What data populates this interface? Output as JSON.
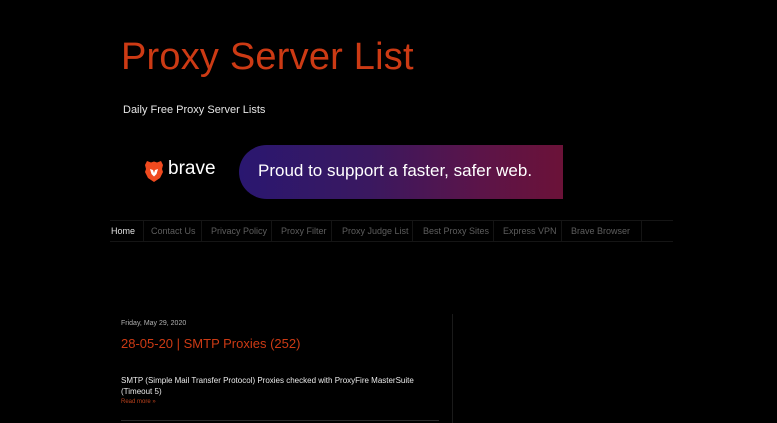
{
  "header": {
    "title": "Proxy Server List",
    "description": "Daily Free Proxy Server Lists"
  },
  "banner": {
    "brand": "brave",
    "tagline": "Proud to support a faster, safer web.",
    "logo_icon": "brave-lion-icon",
    "colors": {
      "gradient_start": "#2a1770",
      "gradient_end": "#6b1238",
      "logo": "#f04a1f"
    }
  },
  "nav": {
    "items": [
      {
        "label": "Home",
        "active": true
      },
      {
        "label": "Contact Us"
      },
      {
        "label": "Privacy Policy"
      },
      {
        "label": "Proxy Filter"
      },
      {
        "label": "Proxy Judge List"
      },
      {
        "label": "Best Proxy Sites"
      },
      {
        "label": "Express VPN"
      },
      {
        "label": "Brave Browser"
      }
    ]
  },
  "post": {
    "date": "Friday, May 29, 2020",
    "title": "28-05-20 | SMTP Proxies (252)",
    "body": "SMTP (Simple Mail Transfer Protocol) Proxies checked with ProxyFire MasterSuite (Timeout 5)",
    "read_more": "Read more »"
  },
  "colors": {
    "accent": "#cc3a14",
    "background": "#000000"
  }
}
